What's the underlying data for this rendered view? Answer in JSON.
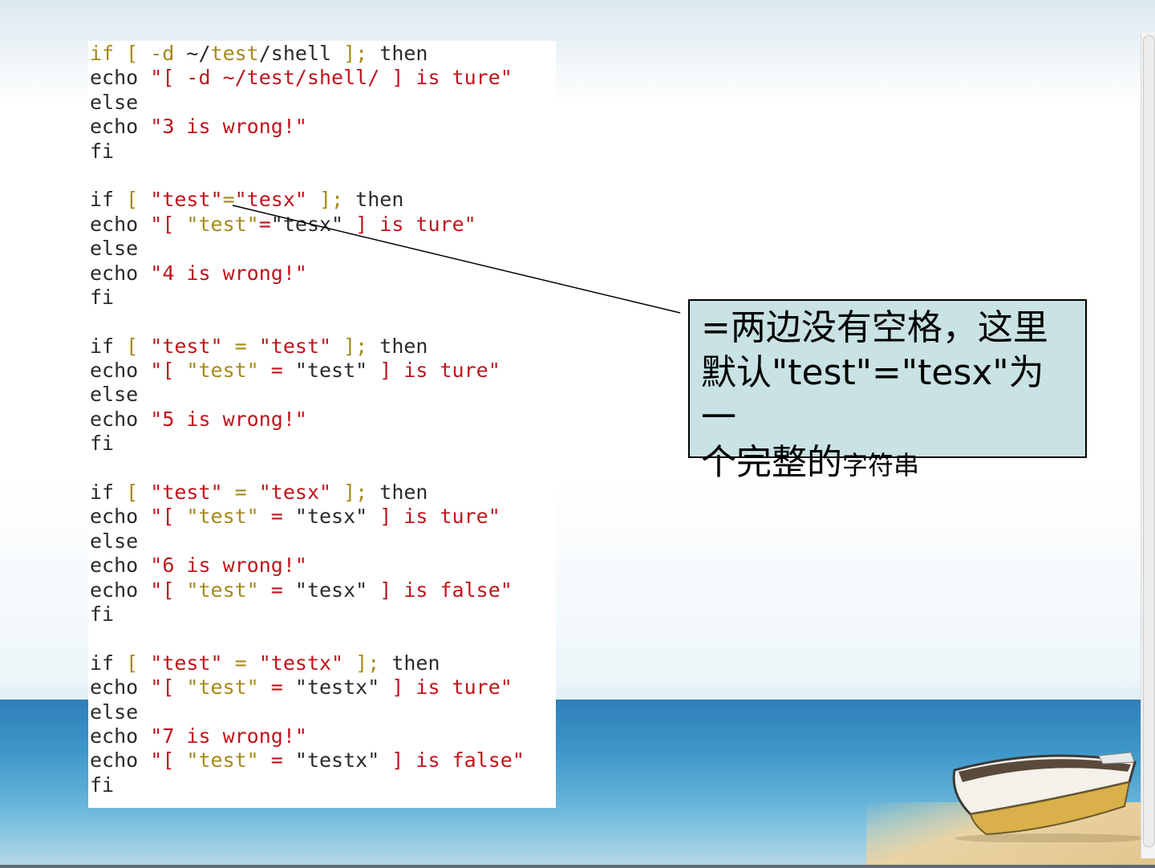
{
  "code_lines": [
    [
      {
        "t": "if [ -d ",
        "c": "kw"
      },
      {
        "t": "~/",
        "c": "plain"
      },
      {
        "t": "test",
        "c": "kw"
      },
      {
        "t": "/shell ",
        "c": "plain"
      },
      {
        "t": "]; ",
        "c": "kw"
      },
      {
        "t": "then",
        "c": "plain"
      }
    ],
    [
      {
        "t": "echo ",
        "c": "plain"
      },
      {
        "t": "\"[ -d ~/test/shell/ ] is ture\"",
        "c": "str"
      }
    ],
    [
      {
        "t": "else",
        "c": "plain"
      }
    ],
    [
      {
        "t": "echo ",
        "c": "plain"
      },
      {
        "t": "\"3 is wrong!\"",
        "c": "str"
      }
    ],
    [
      {
        "t": "fi",
        "c": "plain"
      }
    ],
    [],
    [
      {
        "t": "if ",
        "c": "plain"
      },
      {
        "t": "[ ",
        "c": "kw"
      },
      {
        "t": "\"test\"",
        "c": "str"
      },
      {
        "t": "=",
        "c": "kw"
      },
      {
        "t": "\"tesx\"",
        "c": "str"
      },
      {
        "t": " ]; ",
        "c": "kw"
      },
      {
        "t": "then",
        "c": "plain"
      }
    ],
    [
      {
        "t": "echo ",
        "c": "plain"
      },
      {
        "t": "\"[ ",
        "c": "str"
      },
      {
        "t": "\"test\"",
        "c": "kw"
      },
      {
        "t": "=",
        "c": "str"
      },
      {
        "t": "\"tesx\"",
        "c": "plain"
      },
      {
        "t": " ] is ture\"",
        "c": "str"
      }
    ],
    [
      {
        "t": "else",
        "c": "plain"
      }
    ],
    [
      {
        "t": "echo ",
        "c": "plain"
      },
      {
        "t": "\"4 is wrong!\"",
        "c": "str"
      }
    ],
    [
      {
        "t": "fi",
        "c": "plain"
      }
    ],
    [],
    [
      {
        "t": "if ",
        "c": "plain"
      },
      {
        "t": "[ ",
        "c": "kw"
      },
      {
        "t": "\"test\"",
        "c": "str"
      },
      {
        "t": " = ",
        "c": "kw"
      },
      {
        "t": "\"test\"",
        "c": "str"
      },
      {
        "t": " ]; ",
        "c": "kw"
      },
      {
        "t": "then",
        "c": "plain"
      }
    ],
    [
      {
        "t": "echo ",
        "c": "plain"
      },
      {
        "t": "\"[ ",
        "c": "str"
      },
      {
        "t": "\"test\"",
        "c": "kw"
      },
      {
        "t": " = ",
        "c": "str"
      },
      {
        "t": "\"test\"",
        "c": "plain"
      },
      {
        "t": " ] is ture\"",
        "c": "str"
      }
    ],
    [
      {
        "t": "else",
        "c": "plain"
      }
    ],
    [
      {
        "t": "echo ",
        "c": "plain"
      },
      {
        "t": "\"5 is wrong!\"",
        "c": "str"
      }
    ],
    [
      {
        "t": "fi",
        "c": "plain"
      }
    ],
    [],
    [
      {
        "t": "if ",
        "c": "plain"
      },
      {
        "t": "[ ",
        "c": "kw"
      },
      {
        "t": "\"test\"",
        "c": "str"
      },
      {
        "t": " = ",
        "c": "kw"
      },
      {
        "t": "\"tesx\"",
        "c": "str"
      },
      {
        "t": " ]; ",
        "c": "kw"
      },
      {
        "t": "then",
        "c": "plain"
      }
    ],
    [
      {
        "t": "echo ",
        "c": "plain"
      },
      {
        "t": "\"[ ",
        "c": "str"
      },
      {
        "t": "\"test\"",
        "c": "kw"
      },
      {
        "t": " = ",
        "c": "str"
      },
      {
        "t": "\"tesx\"",
        "c": "plain"
      },
      {
        "t": " ] is ture\"",
        "c": "str"
      }
    ],
    [
      {
        "t": "else",
        "c": "plain"
      }
    ],
    [
      {
        "t": "echo ",
        "c": "plain"
      },
      {
        "t": "\"6 is wrong!\"",
        "c": "str"
      }
    ],
    [
      {
        "t": "echo ",
        "c": "plain"
      },
      {
        "t": "\"[ ",
        "c": "str"
      },
      {
        "t": "\"test\"",
        "c": "kw"
      },
      {
        "t": " = ",
        "c": "str"
      },
      {
        "t": "\"tesx\"",
        "c": "plain"
      },
      {
        "t": " ] is false\"",
        "c": "str"
      }
    ],
    [
      {
        "t": "fi",
        "c": "plain"
      }
    ],
    [],
    [
      {
        "t": "if ",
        "c": "plain"
      },
      {
        "t": "[ ",
        "c": "kw"
      },
      {
        "t": "\"test\"",
        "c": "str"
      },
      {
        "t": " = ",
        "c": "kw"
      },
      {
        "t": "\"testx\"",
        "c": "str"
      },
      {
        "t": " ]; ",
        "c": "kw"
      },
      {
        "t": "then",
        "c": "plain"
      }
    ],
    [
      {
        "t": "echo ",
        "c": "plain"
      },
      {
        "t": "\"[ ",
        "c": "str"
      },
      {
        "t": "\"test\"",
        "c": "kw"
      },
      {
        "t": " = ",
        "c": "str"
      },
      {
        "t": "\"testx\"",
        "c": "plain"
      },
      {
        "t": " ] is ture\"",
        "c": "str"
      }
    ],
    [
      {
        "t": "else",
        "c": "plain"
      }
    ],
    [
      {
        "t": "echo ",
        "c": "plain"
      },
      {
        "t": "\"7 is wrong!\"",
        "c": "str"
      }
    ],
    [
      {
        "t": "echo ",
        "c": "plain"
      },
      {
        "t": "\"[ ",
        "c": "str"
      },
      {
        "t": "\"test\"",
        "c": "kw"
      },
      {
        "t": " = ",
        "c": "str"
      },
      {
        "t": "\"testx\"",
        "c": "plain"
      },
      {
        "t": " ] is false\"",
        "c": "str"
      }
    ],
    [
      {
        "t": "fi",
        "c": "plain"
      }
    ]
  ],
  "callout": {
    "line1": "=两边没有空格，这里",
    "line2": "默认\"test\"=\"tesx\"为一",
    "line3_main": "个完整的",
    "line3_small": "字符串"
  },
  "colors": {
    "keyword": "#a58a1a",
    "string": "#c0141c",
    "plain": "#2b2b2b",
    "callout_bg": "#c9e2e3"
  }
}
